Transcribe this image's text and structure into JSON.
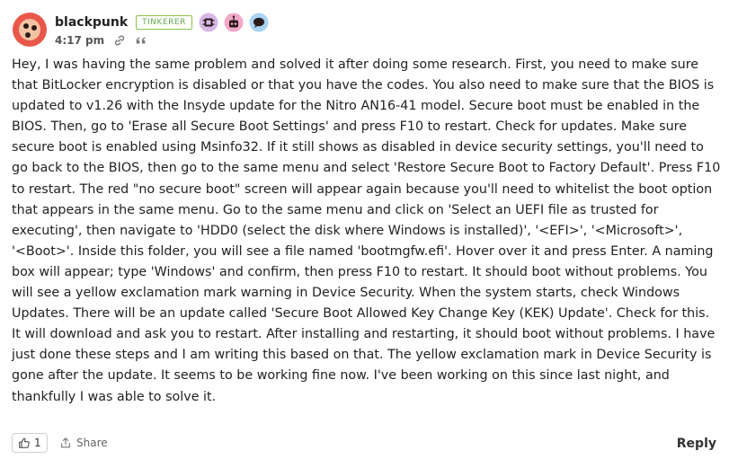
{
  "post": {
    "author": "blackpunk",
    "rank": "TINKERER",
    "time": "4:17 pm",
    "badges": [
      "ai-chip-badge",
      "robot-badge",
      "chat-badge"
    ],
    "paragraphs": [
      "Hey, I was having the same problem and solved it after doing some research. First, you need to make sure that BitLocker encryption is disabled or that you have the codes. You also need to make sure that the BIOS is updated to v1.26 with the Insyde update for the Nitro AN16-41 model. Secure boot must be enabled in the BIOS. Then, go to 'Erase all Secure Boot Settings' and press F10 to restart. Check for updates. Make sure secure boot is enabled using Msinfo32. If it still shows as disabled in device security settings, you'll need to go back to the BIOS, then go to the same menu and select 'Restore Secure Boot to Factory Default'. Press F10 to restart. The red \"no secure boot\" screen will appear again because you'll need to whitelist the boot option that appears in the same menu. Go to the same menu and click on 'Select an UEFI file as trusted for executing', then navigate to 'HDD0 (select the disk where Windows is installed)', '<EFI>', '<Microsoft>', '<Boot>'. Inside this folder, you will see a file named 'bootmgfw.efi'. Hover over it and press Enter. A naming box will appear; type 'Windows' and confirm, then press F10 to restart. It should boot without problems. You will see a yellow exclamation mark warning in Device Security. When the system starts, check Windows Updates. There will be an update called 'Secure Boot Allowed Key Change Key (KEK) Update'. Check for this. It will download and ask you to restart. After installing and restarting, it should boot without problems. I have just done these steps and I am writing this based on that. The yellow exclamation mark in Device Security is gone after the update. It seems to be working fine now. I've been working on this since last night, and thankfully I was able to solve it."
    ]
  },
  "footer": {
    "like_count": "1",
    "share_label": "Share",
    "reply_label": "Reply"
  },
  "colors": {
    "avatar_bg": "#e8574a",
    "rank_border": "#8bc34a",
    "badge_ai": "#d7b8e6",
    "badge_robot": "#f2a9c9",
    "badge_chat": "#a9d3f2"
  }
}
